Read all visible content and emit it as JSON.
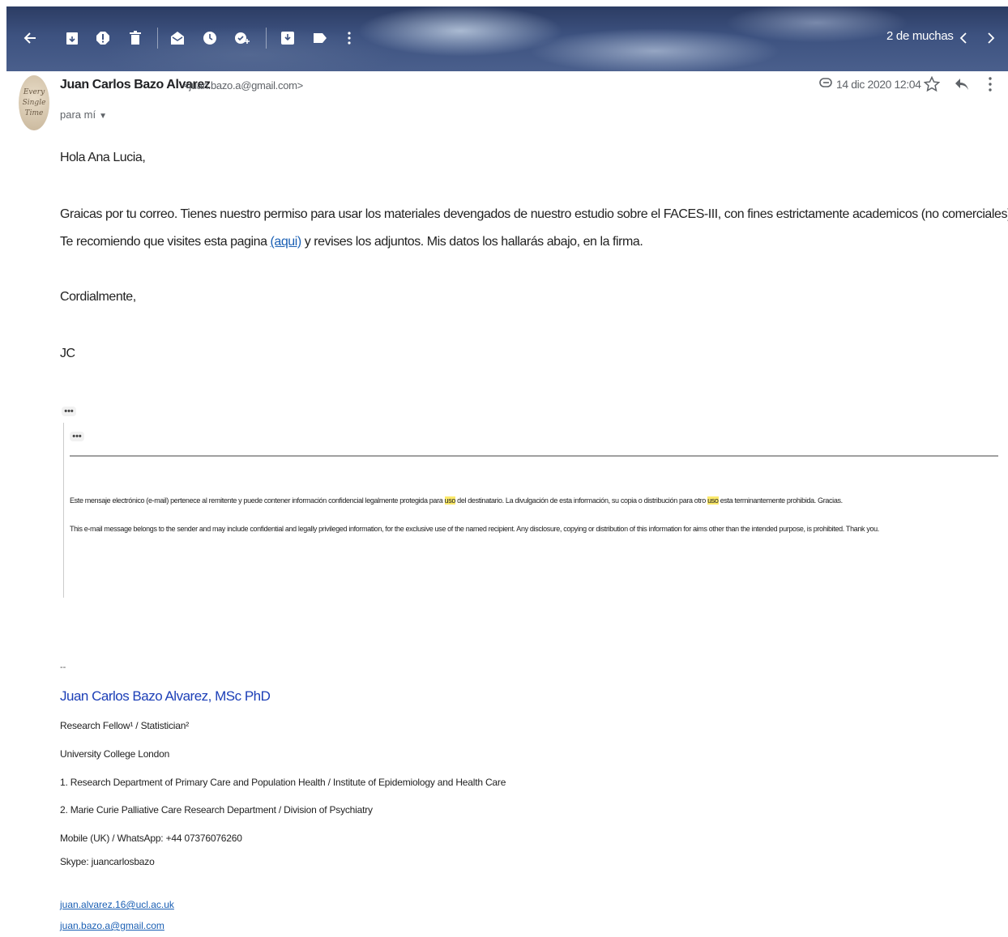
{
  "toolbar": {
    "count": "2 de muchas",
    "icons": [
      "back-arrow-icon",
      "archive-icon",
      "spam-icon",
      "delete-icon",
      "mark-unread-icon",
      "snooze-icon",
      "add-task-icon",
      "move-to-icon",
      "label-icon",
      "more-vert-icon",
      "prev-icon",
      "next-icon"
    ]
  },
  "header": {
    "sender_name": "Juan Carlos Bazo Alvarez",
    "sender_email": "<juan.bazo.a@gmail.com>",
    "to": "para mí",
    "date": "14 dic 2020 12:04",
    "avatar_lines": [
      "Every",
      "Single",
      "Time"
    ]
  },
  "body": {
    "greeting": "Hola Ana Lucia,",
    "line1": "Graicas por tu correo. Tienes nuestro permiso para usar los materiales devengados de nuestro estudio sobre el FACES-III, con fines estrictamente academicos (no comerciales).",
    "line2_before": "Te recomiendo que visites esta pagina ",
    "line2_link": "(aqui)",
    "line2_after": " y revises los adjuntos. Mis datos los hallarás abajo, en la firma.",
    "closing": "Cordialmente,",
    "initials": "JC",
    "ellipsis": "•••"
  },
  "disclaimer": {
    "es_before": "Este mensaje electrónico (e-mail) pertenece al remitente y puede contener  información confidencial legalmente protegida para ",
    "es_hl1": "uso",
    "es_mid": " del destinatario. La divulgación de esta información, su copia o distribución para otro ",
    "es_hl2": "uso",
    "es_after": " esta terminantemente prohibida. Gracias.",
    "en": "This e-mail message belongs to the sender and may include confidential and legally privileged information, for the exclusive use of the named recipient. Any disclosure, copying or distribution of this information for aims other than the intended purpose, is prohibited. Thank you."
  },
  "signature": {
    "dash": "--",
    "name": "Juan Carlos Bazo Alvarez, MSc PhD",
    "role": "Research Fellow¹ / Statistician²",
    "university": "University College London",
    "dept1": "1. Research Department of Primary Care and Population Health / Institute of Epidemiology and Health Care",
    "dept2": "2. Marie Curie Palliative Care Research Department / Division of Psychiatry",
    "mobile": "Mobile (UK) / WhatsApp: +44 07376076260",
    "skype": "Skype: juancarlosbazo",
    "email1": "juan.alvarez.16@ucl.ac.uk",
    "email2": "juan.bazo.a@gmail.com"
  }
}
